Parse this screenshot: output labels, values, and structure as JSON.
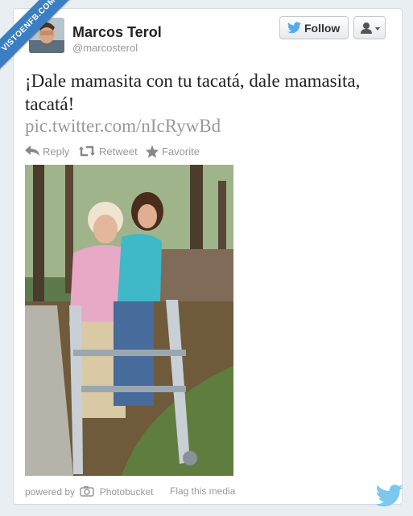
{
  "watermark": {
    "text": "VISTOENFB.COM"
  },
  "tweet": {
    "user": {
      "name": "Marcos Terol",
      "handle": "@marcosterol"
    },
    "follow_label": "Follow",
    "text": "¡Dale mamasita con tu tacatá, dale mamasita, tacatá!",
    "link": "pic.twitter.com/nIcRywBd",
    "actions": [
      {
        "label": "Reply",
        "icon": "reply-icon"
      },
      {
        "label": "Retweet",
        "icon": "retweet-icon"
      },
      {
        "label": "Favorite",
        "icon": "star-icon"
      }
    ]
  },
  "media": {
    "powered_by": "powered by",
    "provider": "Photobucket",
    "flag_label": "Flag this media"
  },
  "colors": {
    "accent": "#3a7fc4",
    "twitter_blue": "#55acee",
    "muted": "#999999"
  }
}
